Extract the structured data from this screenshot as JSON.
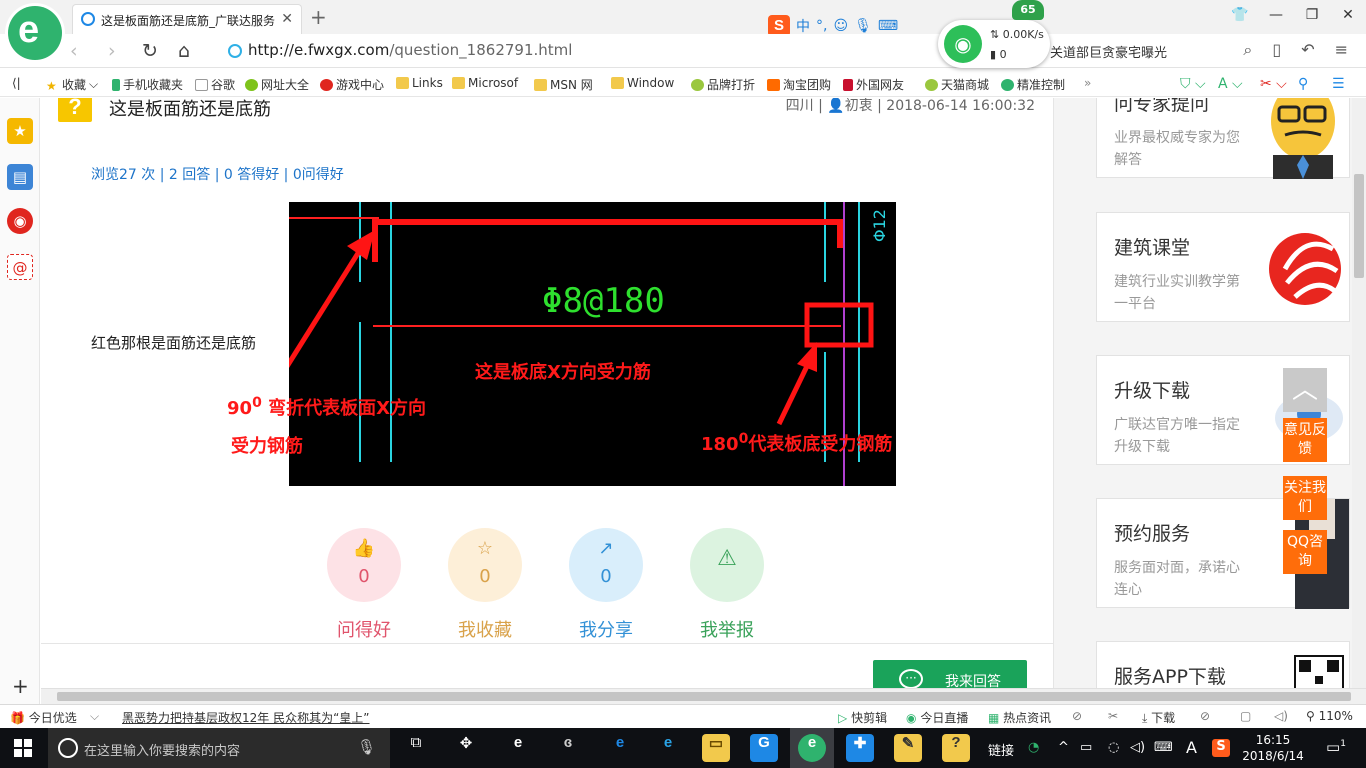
{
  "browser": {
    "tab_title": "这是板面筋还是底筋_广联达服务",
    "url_host": "http://e.fwxgx.com",
    "url_path": "/question_1862791.html",
    "news_ticker": "关道部巨贪豪宅曝光"
  },
  "network_widget": {
    "score": "65",
    "speed": "0.00K/s",
    "count": "0"
  },
  "bookmarks": [
    {
      "label": "收藏",
      "icon": "star-icon"
    },
    {
      "label": "手机收藏夹",
      "icon": "phone-icon"
    },
    {
      "label": "谷歌",
      "icon": "page-icon"
    },
    {
      "label": "网址大全",
      "icon": "globe-icon"
    },
    {
      "label": "游戏中心",
      "icon": "game-icon"
    },
    {
      "label": "Links",
      "icon": "folder-icon"
    },
    {
      "label": "Microsof",
      "icon": "folder-icon"
    },
    {
      "label": "MSN 网",
      "icon": "folder-icon"
    },
    {
      "label": "Window",
      "icon": "folder-icon"
    },
    {
      "label": "品牌打折",
      "icon": "leaf-icon"
    },
    {
      "label": "淘宝团购",
      "icon": "taobao-icon"
    },
    {
      "label": "外国网友",
      "icon": "bookmark-icon"
    },
    {
      "label": "天猫商城",
      "icon": "leaf-icon"
    },
    {
      "label": "精准控制",
      "icon": "chat-icon"
    }
  ],
  "question": {
    "badge": "?",
    "title": "这是板面筋还是底筋",
    "meta": "四川 | 👤初衷 | 2018-06-14 16:00:32",
    "stats": "浏览27 次 | 2 回答 | 0 答得好 | 0问得好",
    "body_text": "红色那根是面筋还是底筋"
  },
  "cad_image": {
    "rebar_label": "Φ8@180",
    "edge_label": "Φ12",
    "annotation_bottom_bar": "这是板底X方向受力筋",
    "annotation_90_prefix": "90",
    "annotation_90_sup": "0",
    "annotation_90_line1": " 弯折代表板面X方向",
    "annotation_90_line2": "受力钢筋",
    "annotation_180_prefix": "180",
    "annotation_180_sup": "0",
    "annotation_180_text": "代表板底受力钢筋"
  },
  "actions": [
    {
      "label": "问得好",
      "count": "0",
      "icon": "thumbs-up-icon",
      "color": "#e0546c",
      "bg": "#fde2e6"
    },
    {
      "label": "我收藏",
      "count": "0",
      "icon": "star-icon",
      "color": "#d9a24a",
      "bg": "#fdefd8"
    },
    {
      "label": "我分享",
      "count": "0",
      "icon": "share-icon",
      "color": "#3391d6",
      "bg": "#d9eefb"
    },
    {
      "label": "我举报",
      "count": "",
      "icon": "warning-icon",
      "color": "#3aa25a",
      "bg": "#dcf3e0"
    }
  ],
  "answer_button": "我来回答",
  "sidebar_cards": [
    {
      "title": "问专家提问",
      "sub": "业界最权威专家为您解答"
    },
    {
      "title": "建筑课堂",
      "sub": "建筑行业实训教学第一平台"
    },
    {
      "title": "升级下载",
      "sub": "广联达官方唯一指定升级下载"
    },
    {
      "title": "预约服务",
      "sub": "服务面对面，承诺心连心"
    },
    {
      "title": "服务APP下载",
      "sub": ""
    }
  ],
  "float_buttons": [
    "意见反馈",
    "关注我们",
    "QQ咨询"
  ],
  "statusbar": {
    "today": "今日优选",
    "headline": "黑恶势力把持基层政权12年 民众称其为“皇上”",
    "quick_cut": "快剪辑",
    "live": "今日直播",
    "hot_news": "热点资讯",
    "download": "下载",
    "zoom": "110%"
  },
  "taskbar": {
    "search_placeholder": "在这里输入你要搜索的内容",
    "tray_link": "链接",
    "ime": "A",
    "time": "16:15",
    "date": "2018/6/14",
    "notifications": "1"
  }
}
